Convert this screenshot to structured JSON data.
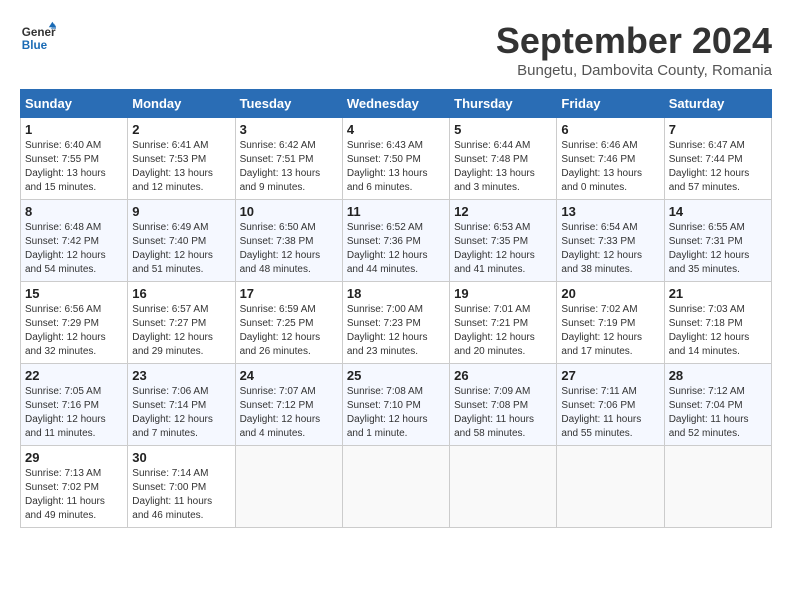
{
  "header": {
    "logo": {
      "line1": "General",
      "line2": "Blue"
    },
    "title": "September 2024",
    "subtitle": "Bungetu, Dambovita County, Romania"
  },
  "weekdays": [
    "Sunday",
    "Monday",
    "Tuesday",
    "Wednesday",
    "Thursday",
    "Friday",
    "Saturday"
  ],
  "weeks": [
    [
      {
        "day": "1",
        "sunrise": "Sunrise: 6:40 AM",
        "sunset": "Sunset: 7:55 PM",
        "daylight": "Daylight: 13 hours and 15 minutes."
      },
      {
        "day": "2",
        "sunrise": "Sunrise: 6:41 AM",
        "sunset": "Sunset: 7:53 PM",
        "daylight": "Daylight: 13 hours and 12 minutes."
      },
      {
        "day": "3",
        "sunrise": "Sunrise: 6:42 AM",
        "sunset": "Sunset: 7:51 PM",
        "daylight": "Daylight: 13 hours and 9 minutes."
      },
      {
        "day": "4",
        "sunrise": "Sunrise: 6:43 AM",
        "sunset": "Sunset: 7:50 PM",
        "daylight": "Daylight: 13 hours and 6 minutes."
      },
      {
        "day": "5",
        "sunrise": "Sunrise: 6:44 AM",
        "sunset": "Sunset: 7:48 PM",
        "daylight": "Daylight: 13 hours and 3 minutes."
      },
      {
        "day": "6",
        "sunrise": "Sunrise: 6:46 AM",
        "sunset": "Sunset: 7:46 PM",
        "daylight": "Daylight: 13 hours and 0 minutes."
      },
      {
        "day": "7",
        "sunrise": "Sunrise: 6:47 AM",
        "sunset": "Sunset: 7:44 PM",
        "daylight": "Daylight: 12 hours and 57 minutes."
      }
    ],
    [
      {
        "day": "8",
        "sunrise": "Sunrise: 6:48 AM",
        "sunset": "Sunset: 7:42 PM",
        "daylight": "Daylight: 12 hours and 54 minutes."
      },
      {
        "day": "9",
        "sunrise": "Sunrise: 6:49 AM",
        "sunset": "Sunset: 7:40 PM",
        "daylight": "Daylight: 12 hours and 51 minutes."
      },
      {
        "day": "10",
        "sunrise": "Sunrise: 6:50 AM",
        "sunset": "Sunset: 7:38 PM",
        "daylight": "Daylight: 12 hours and 48 minutes."
      },
      {
        "day": "11",
        "sunrise": "Sunrise: 6:52 AM",
        "sunset": "Sunset: 7:36 PM",
        "daylight": "Daylight: 12 hours and 44 minutes."
      },
      {
        "day": "12",
        "sunrise": "Sunrise: 6:53 AM",
        "sunset": "Sunset: 7:35 PM",
        "daylight": "Daylight: 12 hours and 41 minutes."
      },
      {
        "day": "13",
        "sunrise": "Sunrise: 6:54 AM",
        "sunset": "Sunset: 7:33 PM",
        "daylight": "Daylight: 12 hours and 38 minutes."
      },
      {
        "day": "14",
        "sunrise": "Sunrise: 6:55 AM",
        "sunset": "Sunset: 7:31 PM",
        "daylight": "Daylight: 12 hours and 35 minutes."
      }
    ],
    [
      {
        "day": "15",
        "sunrise": "Sunrise: 6:56 AM",
        "sunset": "Sunset: 7:29 PM",
        "daylight": "Daylight: 12 hours and 32 minutes."
      },
      {
        "day": "16",
        "sunrise": "Sunrise: 6:57 AM",
        "sunset": "Sunset: 7:27 PM",
        "daylight": "Daylight: 12 hours and 29 minutes."
      },
      {
        "day": "17",
        "sunrise": "Sunrise: 6:59 AM",
        "sunset": "Sunset: 7:25 PM",
        "daylight": "Daylight: 12 hours and 26 minutes."
      },
      {
        "day": "18",
        "sunrise": "Sunrise: 7:00 AM",
        "sunset": "Sunset: 7:23 PM",
        "daylight": "Daylight: 12 hours and 23 minutes."
      },
      {
        "day": "19",
        "sunrise": "Sunrise: 7:01 AM",
        "sunset": "Sunset: 7:21 PM",
        "daylight": "Daylight: 12 hours and 20 minutes."
      },
      {
        "day": "20",
        "sunrise": "Sunrise: 7:02 AM",
        "sunset": "Sunset: 7:19 PM",
        "daylight": "Daylight: 12 hours and 17 minutes."
      },
      {
        "day": "21",
        "sunrise": "Sunrise: 7:03 AM",
        "sunset": "Sunset: 7:18 PM",
        "daylight": "Daylight: 12 hours and 14 minutes."
      }
    ],
    [
      {
        "day": "22",
        "sunrise": "Sunrise: 7:05 AM",
        "sunset": "Sunset: 7:16 PM",
        "daylight": "Daylight: 12 hours and 11 minutes."
      },
      {
        "day": "23",
        "sunrise": "Sunrise: 7:06 AM",
        "sunset": "Sunset: 7:14 PM",
        "daylight": "Daylight: 12 hours and 7 minutes."
      },
      {
        "day": "24",
        "sunrise": "Sunrise: 7:07 AM",
        "sunset": "Sunset: 7:12 PM",
        "daylight": "Daylight: 12 hours and 4 minutes."
      },
      {
        "day": "25",
        "sunrise": "Sunrise: 7:08 AM",
        "sunset": "Sunset: 7:10 PM",
        "daylight": "Daylight: 12 hours and 1 minute."
      },
      {
        "day": "26",
        "sunrise": "Sunrise: 7:09 AM",
        "sunset": "Sunset: 7:08 PM",
        "daylight": "Daylight: 11 hours and 58 minutes."
      },
      {
        "day": "27",
        "sunrise": "Sunrise: 7:11 AM",
        "sunset": "Sunset: 7:06 PM",
        "daylight": "Daylight: 11 hours and 55 minutes."
      },
      {
        "day": "28",
        "sunrise": "Sunrise: 7:12 AM",
        "sunset": "Sunset: 7:04 PM",
        "daylight": "Daylight: 11 hours and 52 minutes."
      }
    ],
    [
      {
        "day": "29",
        "sunrise": "Sunrise: 7:13 AM",
        "sunset": "Sunset: 7:02 PM",
        "daylight": "Daylight: 11 hours and 49 minutes."
      },
      {
        "day": "30",
        "sunrise": "Sunrise: 7:14 AM",
        "sunset": "Sunset: 7:00 PM",
        "daylight": "Daylight: 11 hours and 46 minutes."
      },
      null,
      null,
      null,
      null,
      null
    ]
  ]
}
